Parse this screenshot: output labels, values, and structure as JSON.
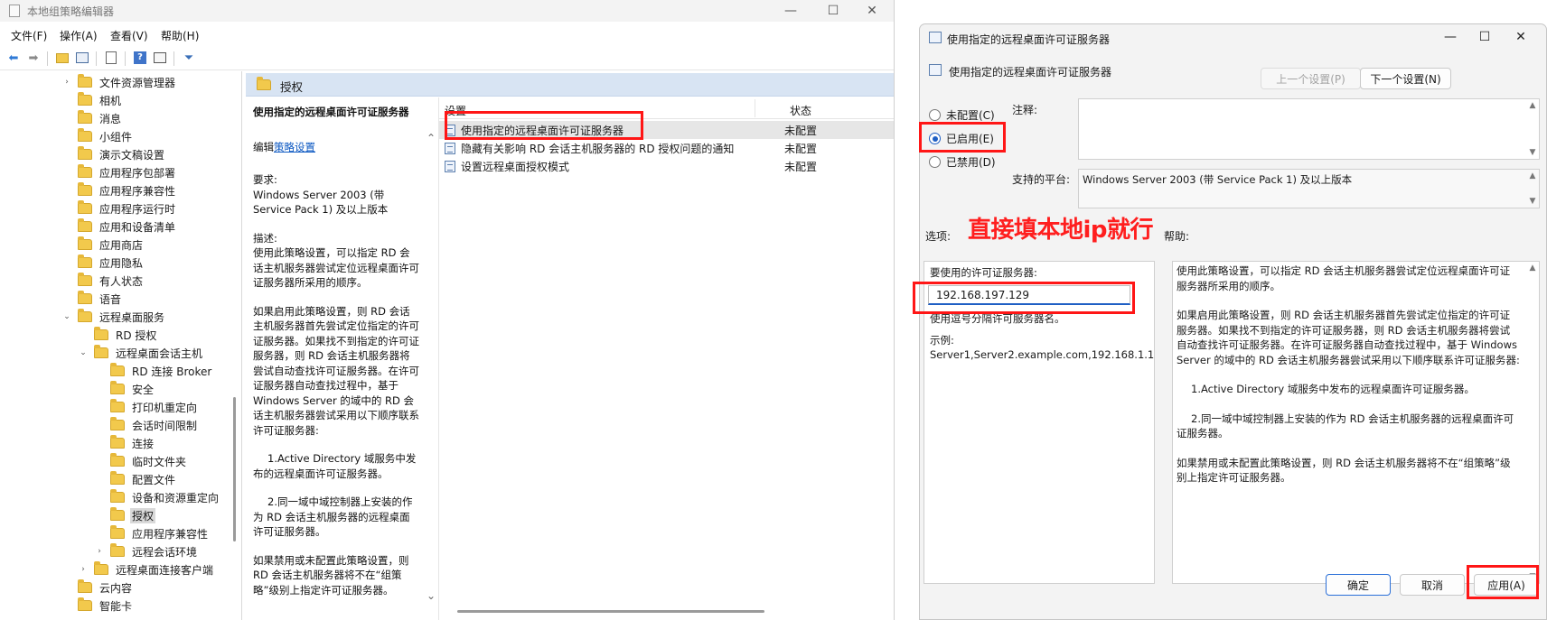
{
  "gpe": {
    "title": "本地组策略编辑器",
    "menu": [
      "文件(F)",
      "操作(A)",
      "查看(V)",
      "帮助(H)"
    ],
    "tree": [
      {
        "label": "文件资源管理器",
        "indent": 0,
        "arrow": "›"
      },
      {
        "label": "相机",
        "indent": 0,
        "arrow": ""
      },
      {
        "label": "消息",
        "indent": 0,
        "arrow": ""
      },
      {
        "label": "小组件",
        "indent": 0,
        "arrow": ""
      },
      {
        "label": "演示文稿设置",
        "indent": 0,
        "arrow": ""
      },
      {
        "label": "应用程序包部署",
        "indent": 0,
        "arrow": ""
      },
      {
        "label": "应用程序兼容性",
        "indent": 0,
        "arrow": ""
      },
      {
        "label": "应用程序运行时",
        "indent": 0,
        "arrow": ""
      },
      {
        "label": "应用和设备清单",
        "indent": 0,
        "arrow": ""
      },
      {
        "label": "应用商店",
        "indent": 0,
        "arrow": ""
      },
      {
        "label": "应用隐私",
        "indent": 0,
        "arrow": ""
      },
      {
        "label": "有人状态",
        "indent": 0,
        "arrow": ""
      },
      {
        "label": "语音",
        "indent": 0,
        "arrow": ""
      },
      {
        "label": "远程桌面服务",
        "indent": 0,
        "arrow": "⌄"
      },
      {
        "label": "RD 授权",
        "indent": 1,
        "arrow": ""
      },
      {
        "label": "远程桌面会话主机",
        "indent": 1,
        "arrow": "⌄"
      },
      {
        "label": "RD 连接 Broker",
        "indent": 2,
        "arrow": ""
      },
      {
        "label": "安全",
        "indent": 2,
        "arrow": ""
      },
      {
        "label": "打印机重定向",
        "indent": 2,
        "arrow": ""
      },
      {
        "label": "会话时间限制",
        "indent": 2,
        "arrow": ""
      },
      {
        "label": "连接",
        "indent": 2,
        "arrow": ""
      },
      {
        "label": "临时文件夹",
        "indent": 2,
        "arrow": ""
      },
      {
        "label": "配置文件",
        "indent": 2,
        "arrow": ""
      },
      {
        "label": "设备和资源重定向",
        "indent": 2,
        "arrow": ""
      },
      {
        "label": "授权",
        "indent": 2,
        "arrow": "",
        "selected": true
      },
      {
        "label": "应用程序兼容性",
        "indent": 2,
        "arrow": ""
      },
      {
        "label": "远程会话环境",
        "indent": 2,
        "arrow": "›"
      },
      {
        "label": "远程桌面连接客户端",
        "indent": 1,
        "arrow": "›"
      },
      {
        "label": "云内容",
        "indent": 0,
        "arrow": ""
      },
      {
        "label": "智能卡",
        "indent": 0,
        "arrow": ""
      }
    ],
    "breadcrumb": "授权",
    "description": {
      "title": "使用指定的远程桌面许可证服务器",
      "edit_prefix": "编辑",
      "edit_link": "策略设置",
      "requirements_label": "要求:",
      "requirements": "Windows Server 2003 (带 Service Pack 1) 及以上版本",
      "desc_label": "描述:",
      "p1": "使用此策略设置，可以指定 RD 会话主机服务器尝试定位远程桌面许可证服务器所采用的顺序。",
      "p2": "如果启用此策略设置，则 RD 会话主机服务器首先尝试定位指定的许可证服务器。如果找不到指定的许可证服务器，则 RD 会话主机服务器将尝试自动查找许可证服务器。在许可证服务器自动查找过程中，基于 Windows Server 的域中的 RD 会话主机服务器尝试采用以下顺序联系许可证服务器:",
      "p3": "1.Active Directory 域服务中发布的远程桌面许可证服务器。",
      "p4": "2.同一域中域控制器上安装的作为 RD 会话主机服务器的远程桌面许可证服务器。",
      "p5": "如果禁用或未配置此策略设置，则 RD 会话主机服务器将不在“组策略”级别上指定许可证服务器。"
    },
    "list": {
      "col_setting": "设置",
      "col_state": "状态",
      "rows": [
        {
          "name": "使用指定的远程桌面许可证服务器",
          "state": "未配置",
          "selected": true
        },
        {
          "name": "隐藏有关影响 RD 会话主机服务器的 RD 授权问题的通知",
          "state": "未配置"
        },
        {
          "name": "设置远程桌面授权模式",
          "state": "未配置"
        }
      ]
    }
  },
  "dialog": {
    "title": "使用指定的远程桌面许可证服务器",
    "subtitle": "使用指定的远程桌面许可证服务器",
    "prev_button": "上一个设置(P)",
    "next_button": "下一个设置(N)",
    "radio_not_configured": "未配置(C)",
    "radio_enabled": "已启用(E)",
    "radio_disabled": "已禁用(D)",
    "comment_label": "注释:",
    "platform_label": "支持的平台:",
    "platform_value": "Windows Server 2003 (带 Service Pack 1) 及以上版本",
    "options_label": "选项:",
    "help_label": "帮助:",
    "options": {
      "server_label": "要使用的许可证服务器:",
      "server_value": "192.168.197.129",
      "hint": "使用逗号分隔许可服务器名。",
      "example_label": "示例:",
      "example_value": "Server1,Server2.example.com,192.168.1.1"
    },
    "help": {
      "p1": "使用此策略设置，可以指定 RD 会话主机服务器尝试定位远程桌面许可证服务器所采用的顺序。",
      "p2": "如果启用此策略设置，则 RD 会话主机服务器首先尝试定位指定的许可证服务器。如果找不到指定的许可证服务器，则 RD 会话主机服务器将尝试自动查找许可证服务器。在许可证服务器自动查找过程中，基于 Windows Server 的域中的 RD 会话主机服务器尝试采用以下顺序联系许可证服务器:",
      "p3": "1.Active Directory 域服务中发布的远程桌面许可证服务器。",
      "p4": "2.同一域中域控制器上安装的作为 RD 会话主机服务器的远程桌面许可证服务器。",
      "p5": "如果禁用或未配置此策略设置，则 RD 会话主机服务器将不在“组策略”级别上指定许可证服务器。"
    },
    "ok_button": "确定",
    "cancel_button": "取消",
    "apply_button": "应用(A)"
  },
  "annotation": "直接填本地ip就行",
  "colors": {
    "highlight_red": "#ff1616",
    "accent_blue": "#1f5fc4",
    "breadcrumb_bg": "#d8e4f3"
  }
}
